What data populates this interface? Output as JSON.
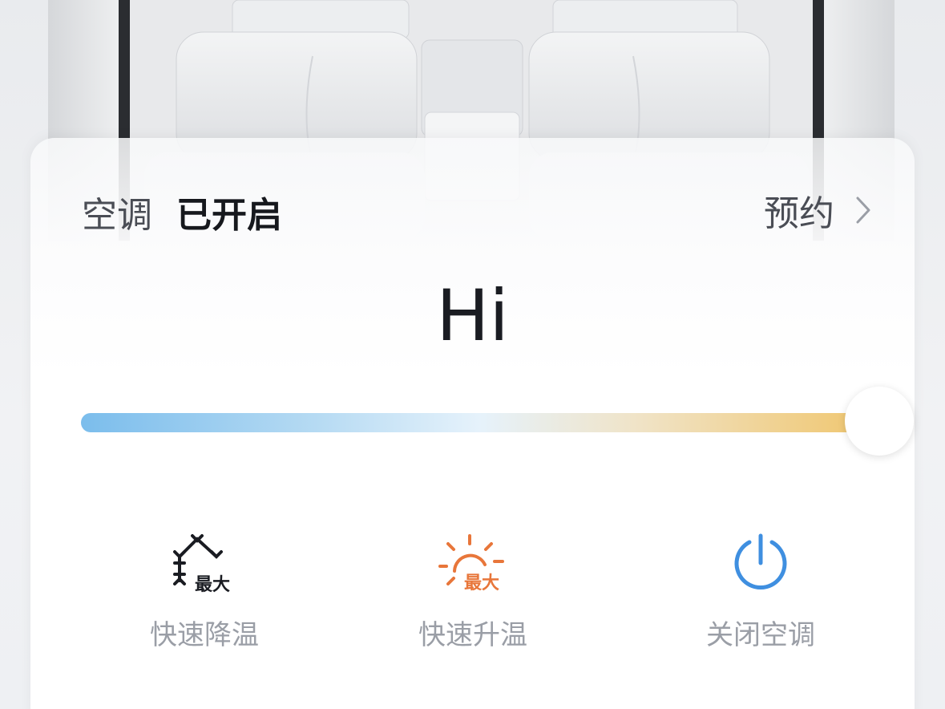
{
  "header": {
    "label": "空调",
    "status": "已开启",
    "schedule_label": "预约"
  },
  "temperature": {
    "value": "Hi",
    "level": 1.0
  },
  "actions": [
    {
      "id": "max-cool",
      "label": "快速降温",
      "icon": "snowflake-max-icon",
      "badge": "最大",
      "color": "#1a1c22"
    },
    {
      "id": "max-heat",
      "label": "快速升温",
      "icon": "sun-max-icon",
      "badge": "最大",
      "color": "#e8763a"
    },
    {
      "id": "power-off",
      "label": "关闭空调",
      "icon": "power-icon",
      "color": "#3f8fe0"
    }
  ],
  "colors": {
    "cool": "#7bbdec",
    "warm": "#f0c56b",
    "heat_accent": "#e8763a",
    "power_accent": "#3f8fe0"
  }
}
